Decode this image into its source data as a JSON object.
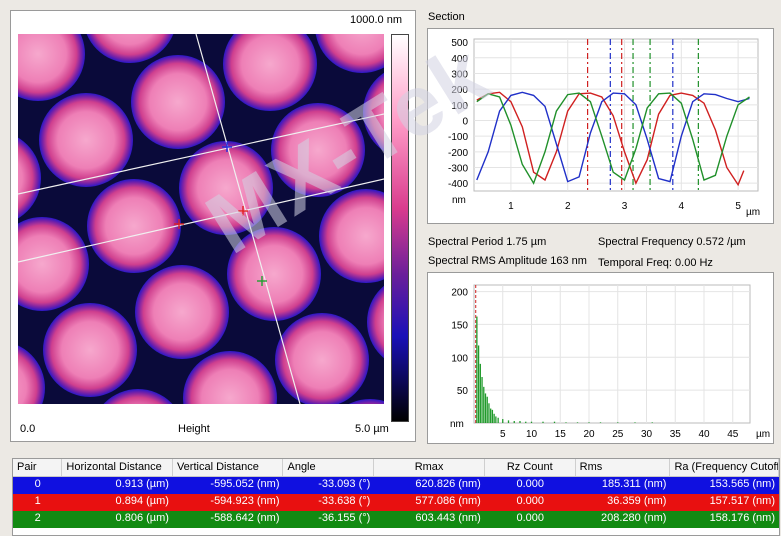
{
  "toolbar": {
    "tools": [
      {
        "icon": "ruler-icon",
        "active": true
      },
      {
        "icon": "hand-icon",
        "active": false
      },
      {
        "icon": "zoom-icon",
        "active": false
      },
      {
        "icon": "zoom-in-icon",
        "active": false
      },
      {
        "icon": "zoom-out-icon",
        "active": false
      }
    ]
  },
  "image_panel": {
    "scale_top": "1000.0 nm",
    "x_min": "0.0",
    "x_label": "Height",
    "x_max": "5.0 µm"
  },
  "section": {
    "title": "Section",
    "chart_data": {
      "type": "line",
      "yticks": [
        "500",
        "400",
        "300",
        "200",
        "100",
        "0",
        "-100",
        "-200",
        "-300",
        "-400"
      ],
      "ylim": [
        -450,
        520
      ],
      "ylabel": "nm",
      "xticks": [
        "1",
        "2",
        "3",
        "4",
        "5"
      ],
      "xlim": [
        0.35,
        5.35
      ],
      "xlabel": "µm",
      "series": [
        {
          "color": "#d02020",
          "x": [
            0.4,
            0.6,
            0.8,
            1.0,
            1.2,
            1.4,
            1.6,
            1.8,
            2.0,
            2.2,
            2.4,
            2.6,
            2.8,
            3.0,
            3.2,
            3.4,
            3.6,
            3.8,
            4.0,
            4.2,
            4.4,
            4.6,
            4.8,
            5.0,
            5.1
          ],
          "y": [
            130,
            170,
            180,
            120,
            -40,
            -330,
            -380,
            -200,
            60,
            170,
            175,
            150,
            30,
            -200,
            -400,
            -250,
            40,
            160,
            175,
            160,
            110,
            -60,
            -300,
            -410,
            -320
          ]
        },
        {
          "color": "#2030c8",
          "x": [
            0.4,
            0.6,
            0.8,
            1.0,
            1.2,
            1.4,
            1.6,
            1.8,
            2.0,
            2.2,
            2.4,
            2.6,
            2.8,
            3.0,
            3.2,
            3.4,
            3.6,
            3.8,
            4.0,
            4.2,
            4.4,
            4.6,
            4.8,
            5.0,
            5.2
          ],
          "y": [
            -380,
            -200,
            60,
            160,
            180,
            160,
            90,
            -150,
            -390,
            -360,
            -80,
            120,
            175,
            170,
            100,
            -120,
            -370,
            -390,
            -100,
            120,
            170,
            165,
            140,
            120,
            140
          ]
        },
        {
          "color": "#20902a",
          "x": [
            0.4,
            0.6,
            0.8,
            1.0,
            1.2,
            1.4,
            1.6,
            1.8,
            2.0,
            2.2,
            2.4,
            2.6,
            2.8,
            3.0,
            3.2,
            3.4,
            3.6,
            3.8,
            4.0,
            4.2,
            4.4,
            4.6,
            4.8,
            5.0,
            5.2
          ],
          "y": [
            120,
            170,
            150,
            -30,
            -280,
            -400,
            -200,
            60,
            165,
            175,
            120,
            -100,
            -330,
            -380,
            -180,
            80,
            170,
            175,
            110,
            -120,
            -380,
            -350,
            -100,
            100,
            150
          ]
        }
      ],
      "markers": [
        {
          "x": 2.35,
          "color": "#d02020"
        },
        {
          "x": 2.75,
          "color": "#2030c8"
        },
        {
          "x": 2.95,
          "color": "#d02020"
        },
        {
          "x": 3.15,
          "color": "#20902a"
        },
        {
          "x": 3.45,
          "color": "#20902a"
        },
        {
          "x": 3.85,
          "color": "#2030c8"
        },
        {
          "x": 4.3,
          "color": "#20902a"
        }
      ]
    }
  },
  "stats": {
    "spectral_period": "Spectral Period 1.75 µm",
    "spectral_frequency": "Spectral Frequency 0.572 /µm",
    "spectral_rms": "Spectral RMS Amplitude 163 nm",
    "temporal_freq": "Temporal Freq: 0.00 Hz"
  },
  "spectrum": {
    "chart_data": {
      "type": "bar",
      "yticks": [
        "200",
        "150",
        "100",
        "50"
      ],
      "ylim": [
        0,
        210
      ],
      "ylabel": "nm",
      "xticks": [
        "5",
        "10",
        "15",
        "20",
        "25",
        "30",
        "35",
        "40",
        "45"
      ],
      "xlim": [
        0,
        48
      ],
      "xlabel": "µm",
      "marker_x": 0.3,
      "x": [
        0.5,
        0.8,
        1.1,
        1.4,
        1.7,
        2.0,
        2.3,
        2.6,
        2.9,
        3.2,
        3.5,
        3.8,
        4.2,
        5,
        6,
        7,
        8,
        9,
        10,
        12,
        14,
        16,
        18,
        20,
        22,
        25,
        28,
        31
      ],
      "values": [
        162,
        118,
        90,
        70,
        55,
        45,
        40,
        30,
        22,
        20,
        14,
        10,
        8,
        6,
        4,
        3,
        3,
        2,
        2,
        2,
        2,
        1,
        1,
        1,
        1,
        1,
        1,
        1
      ]
    }
  },
  "table": {
    "headers": [
      "Pair",
      "Horizontal Distance",
      "Vertical Distance",
      "Angle",
      "Rmax",
      "Rz Count",
      "Rms",
      "Ra (Frequency Cutoff)"
    ],
    "rows": [
      {
        "color": "#1010e0",
        "cells": [
          "0",
          "0.913  (µm)",
          "-595.052  (nm)",
          "-33.093  (°)",
          "620.826  (nm)",
          "0.000",
          "185.311  (nm)",
          "153.565  (nm)"
        ]
      },
      {
        "color": "#e81010",
        "cells": [
          "1",
          "0.894  (µm)",
          "-594.923  (nm)",
          "-33.638  (°)",
          "577.086  (nm)",
          "0.000",
          "36.359  (nm)",
          "157.517  (nm)"
        ]
      },
      {
        "color": "#128a12",
        "cells": [
          "2",
          "0.806  (µm)",
          "-588.642  (nm)",
          "-36.155  (°)",
          "603.443  (nm)",
          "0.000",
          "208.280  (nm)",
          "158.176  (nm)"
        ]
      }
    ]
  }
}
